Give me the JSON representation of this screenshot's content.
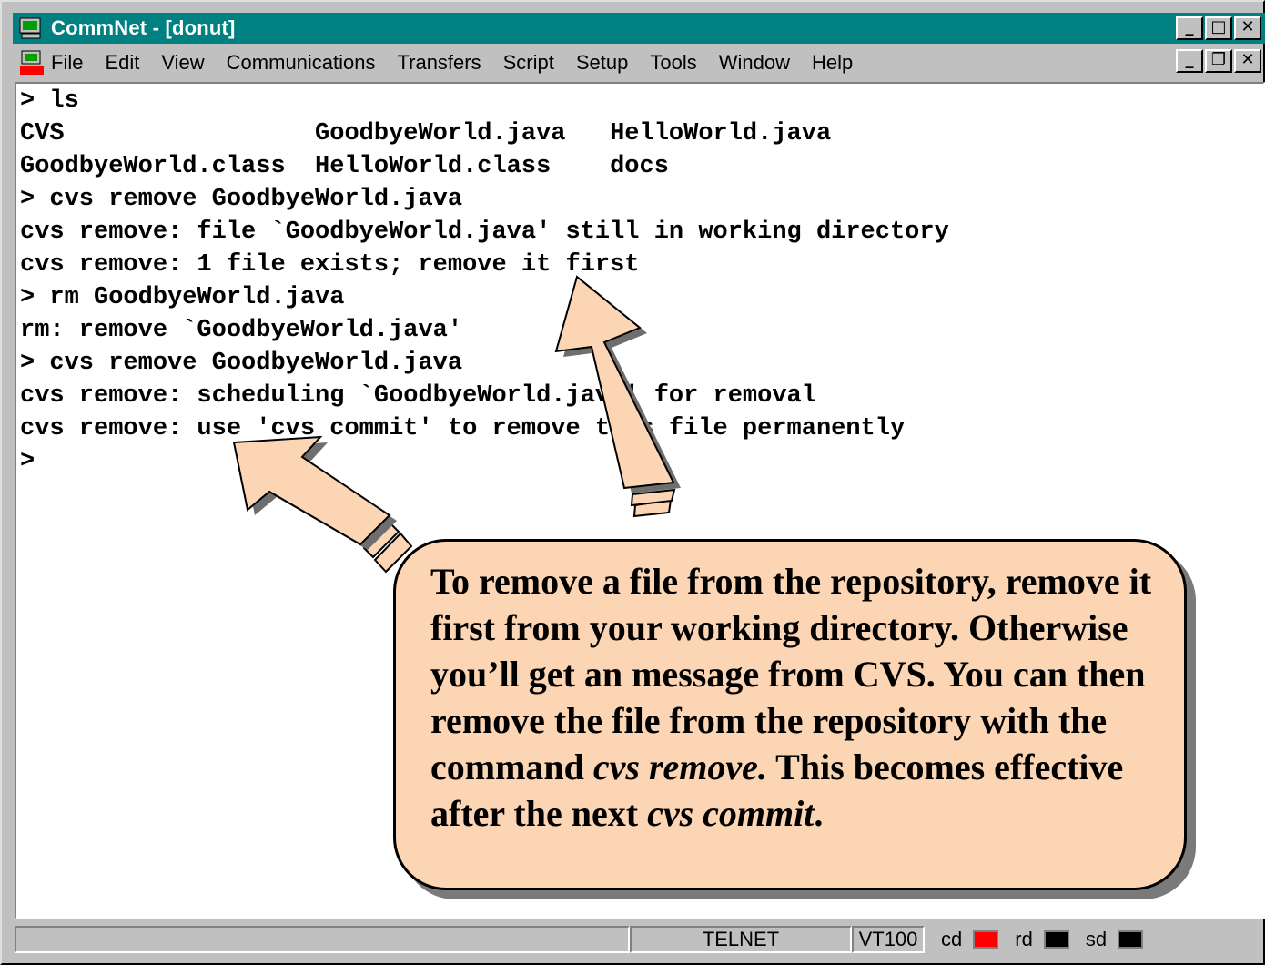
{
  "window": {
    "title": "CommNet - [donut]",
    "controls": {
      "minimize": "_",
      "maximize": "□",
      "close": "✕"
    },
    "mdi_controls": {
      "minimize": "_",
      "restore": "❐",
      "close": "✕"
    }
  },
  "menu": [
    "File",
    "Edit",
    "View",
    "Communications",
    "Transfers",
    "Script",
    "Setup",
    "Tools",
    "Window",
    "Help"
  ],
  "terminal": {
    "lines": [
      "> ls",
      "CVS                 GoodbyeWorld.java   HelloWorld.java",
      "GoodbyeWorld.class  HelloWorld.class    docs",
      "> cvs remove GoodbyeWorld.java",
      "cvs remove: file `GoodbyeWorld.java' still in working directory",
      "cvs remove: 1 file exists; remove it first",
      "> rm GoodbyeWorld.java",
      "rm: remove `GoodbyeWorld.java'",
      "> cvs remove GoodbyeWorld.java",
      "cvs remove: scheduling `GoodbyeWorld.java' for removal",
      "cvs remove: use 'cvs commit' to remove this file permanently",
      ">"
    ]
  },
  "callout": {
    "text_plain": "To remove a file from the repository, remove it first from your working directory. Otherwise you’ll get an message from CVS. You can then remove the file from the repository with the command ",
    "cmd1": "cvs remove.",
    "text_mid": " This becomes effective after the next ",
    "cmd2": "cvs commit",
    "text_end": "."
  },
  "status": {
    "protocol": "TELNET",
    "emulation": "VT100",
    "leds": [
      {
        "label": "cd",
        "color": "#ff0000"
      },
      {
        "label": "rd",
        "color": "#000000"
      },
      {
        "label": "sd",
        "color": "#000000"
      }
    ]
  },
  "colors": {
    "titlebar": "#008080",
    "callout_fill": "#fcd5b4",
    "chrome": "#c0c0c0"
  }
}
